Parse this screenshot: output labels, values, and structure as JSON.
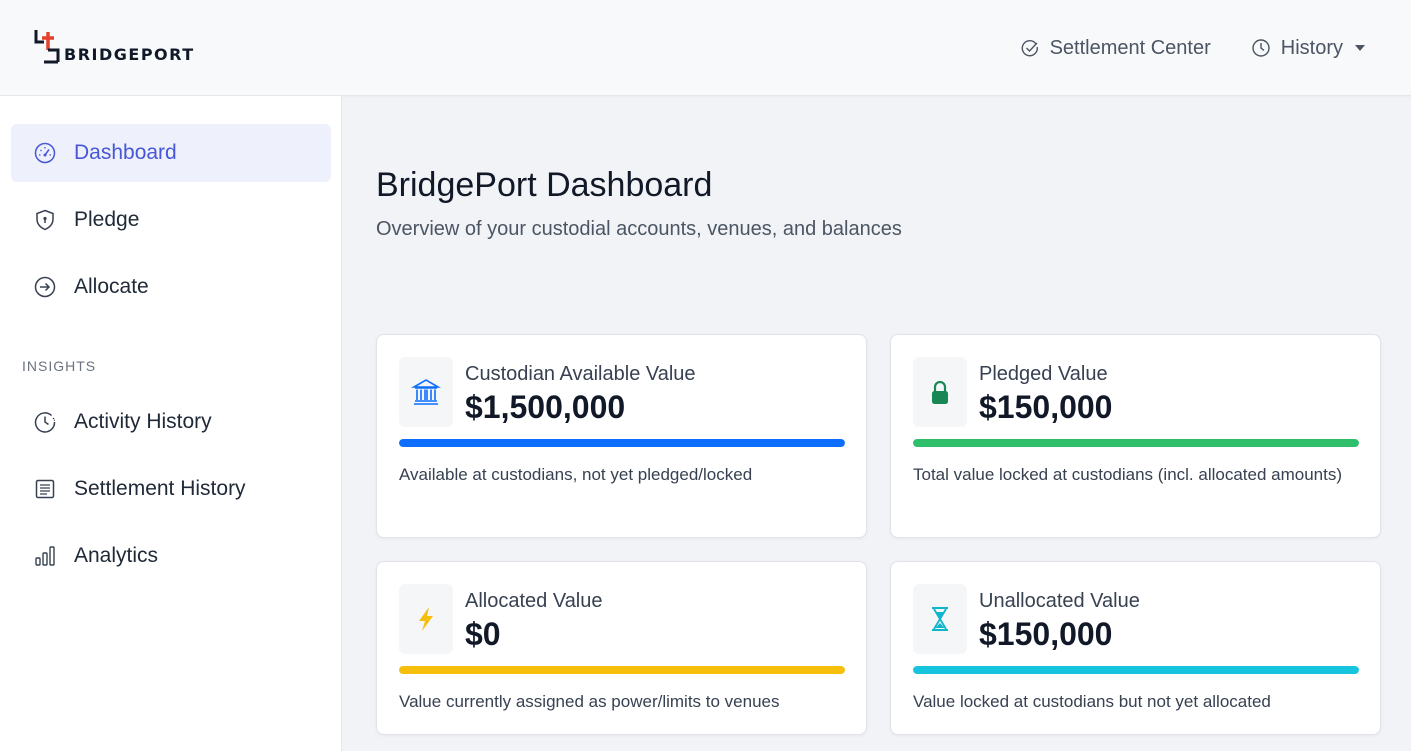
{
  "brand": {
    "name": "BRIDGEPORT"
  },
  "topnav": {
    "settlement_center": "Settlement Center",
    "history": "History"
  },
  "sidebar": {
    "items": [
      {
        "label": "Dashboard",
        "icon": "speedometer-icon",
        "active": true
      },
      {
        "label": "Pledge",
        "icon": "shield-icon",
        "active": false
      },
      {
        "label": "Allocate",
        "icon": "arrow-right-circle-icon",
        "active": false
      }
    ],
    "section_label": "INSIGHTS",
    "insights": [
      {
        "label": "Activity History",
        "icon": "clock-icon"
      },
      {
        "label": "Settlement History",
        "icon": "list-icon"
      },
      {
        "label": "Analytics",
        "icon": "bar-chart-icon"
      }
    ]
  },
  "main": {
    "title": "BridgePort Dashboard",
    "subtitle": "Overview of your custodial accounts, venues, and balances",
    "cards": [
      {
        "label": "Custodian Available Value",
        "value": "$1,500,000",
        "description": "Available at custodians, not yet pledged/locked",
        "icon": "bank-icon",
        "color": "#0d6efd",
        "fill": 1.0
      },
      {
        "label": "Pledged Value",
        "value": "$150,000",
        "description": "Total value locked at custodians (incl. allocated amounts)",
        "icon": "lock-icon",
        "color": "#2fbe6a",
        "fill": 1.0
      },
      {
        "label": "Allocated Value",
        "value": "$0",
        "description": "Value currently assigned as power/limits to venues",
        "icon": "lightning-icon",
        "color": "#f5bf0c",
        "fill": 1.0
      },
      {
        "label": "Unallocated Value",
        "value": "$150,000",
        "description": "Value locked at custodians but not yet allocated",
        "icon": "hourglass-icon",
        "color": "#16c4dd",
        "fill": 1.0
      }
    ]
  }
}
